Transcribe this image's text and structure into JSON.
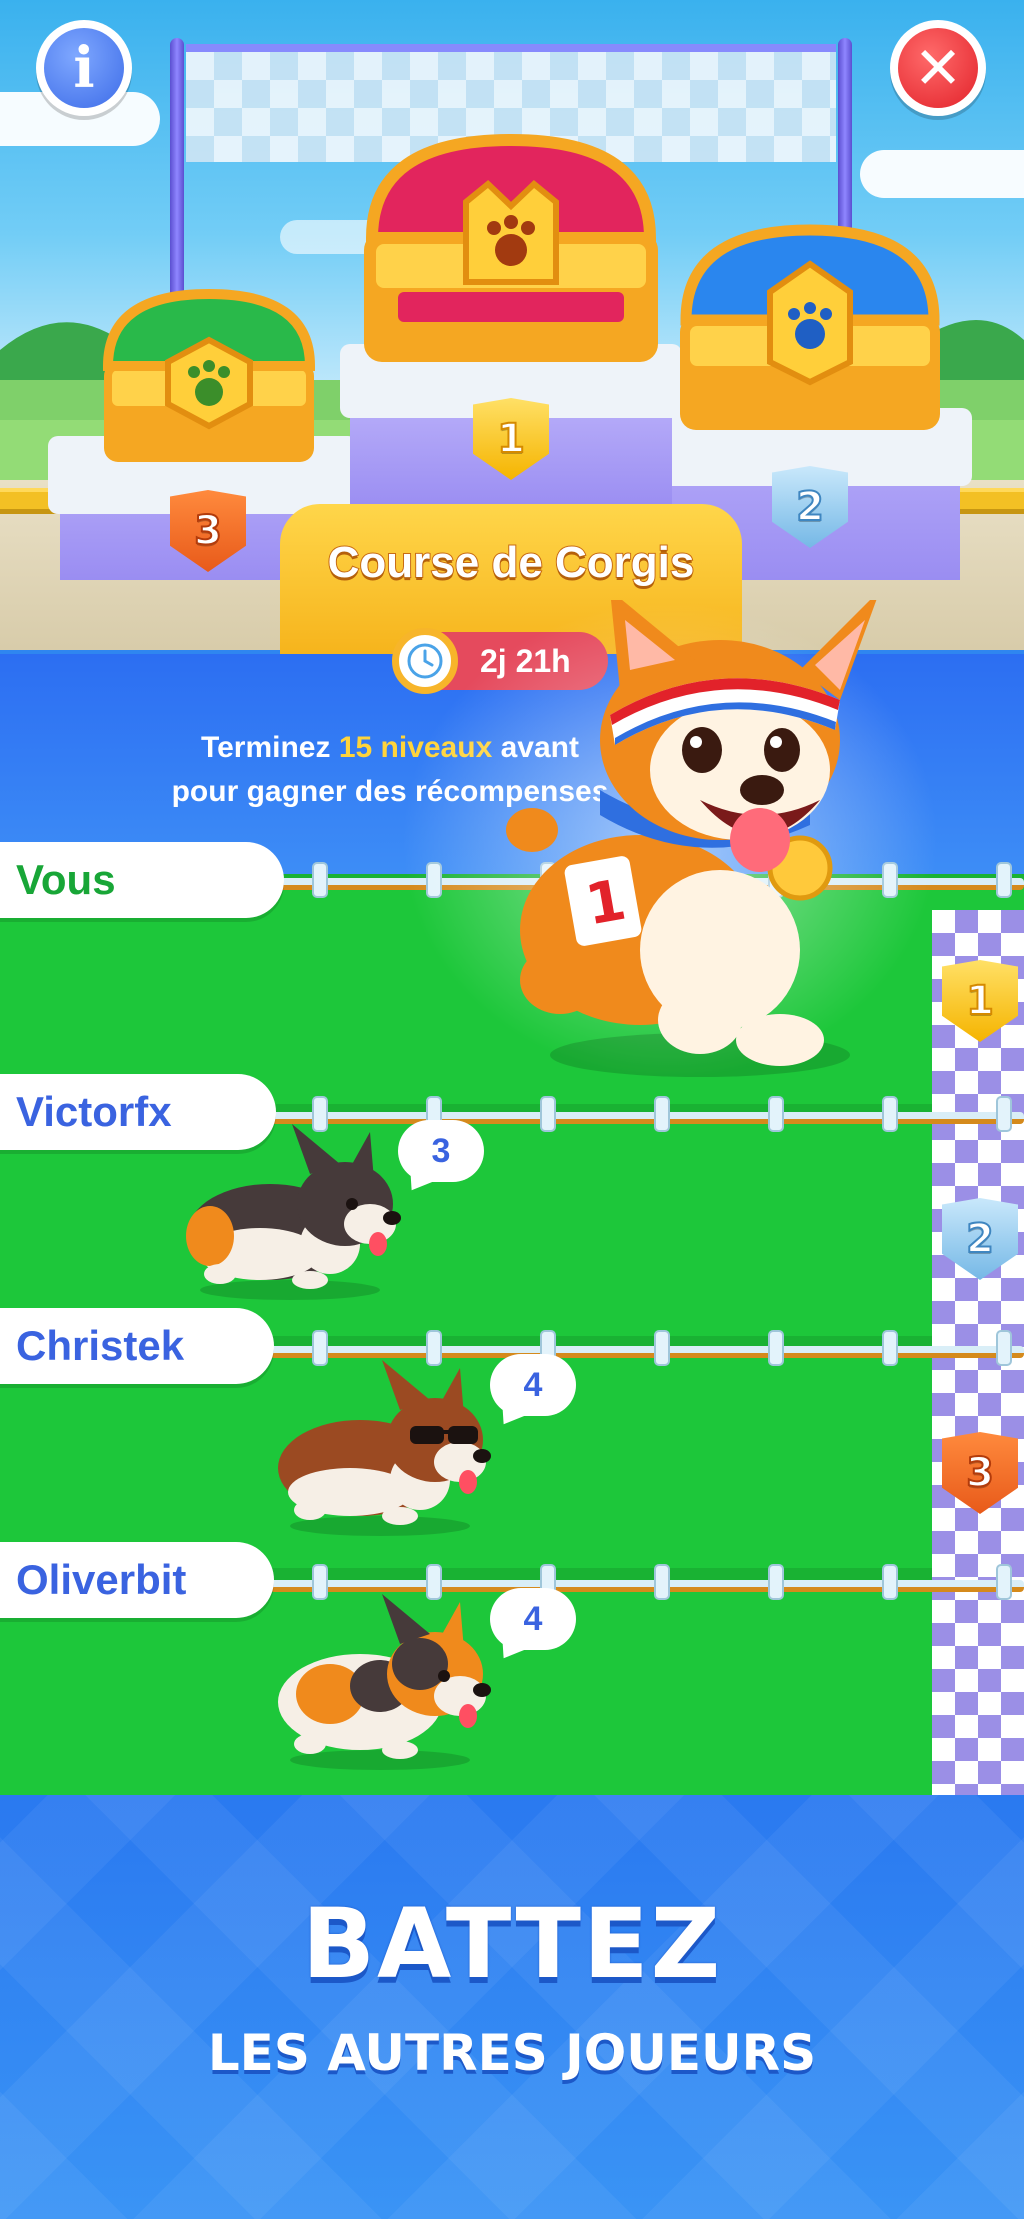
{
  "header": {
    "info_label": "i",
    "close_label": "✕"
  },
  "podium": {
    "first_rank": "1",
    "second_rank": "2",
    "third_rank": "3"
  },
  "event": {
    "title": "Course de Corgis",
    "timer": "2j 21h",
    "instruction_prefix": "Terminez ",
    "instruction_highlight": "15 niveaux",
    "instruction_rest": " avant",
    "instruction_line2": "pour gagner des récompenses"
  },
  "player": {
    "bib_number": "1"
  },
  "lanes": [
    {
      "name": "Vous",
      "name_color": "#18a637"
    },
    {
      "name": "Victorfx",
      "name_color": "#3a63e0",
      "score": "3"
    },
    {
      "name": "Christek",
      "name_color": "#3a63e0",
      "score": "4"
    },
    {
      "name": "Oliverbit",
      "name_color": "#3a63e0",
      "score": "4"
    }
  ],
  "finish_badges": [
    "1",
    "2",
    "3"
  ],
  "promo": {
    "headline": "BATTEZ",
    "subline": "LES AUTRES JOUEURS"
  },
  "colors": {
    "accent_blue": "#2f86f0",
    "grass": "#1dc73a",
    "gold": "#f6b41c",
    "timer_red": "#e54a5d"
  }
}
